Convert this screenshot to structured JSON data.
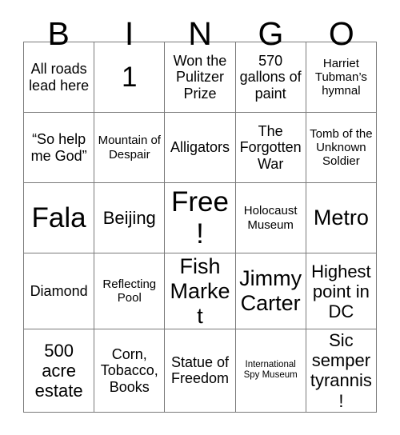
{
  "card": {
    "header_letters": [
      "B",
      "I",
      "N",
      "G",
      "O"
    ],
    "columns": 5,
    "rows": 5,
    "border_color": "#7a7a7a",
    "background_color": "#ffffff",
    "text_color": "#000000",
    "free_space": "Free!",
    "cells": [
      [
        {
          "text": "All roads lead here",
          "size": "sz-md"
        },
        {
          "text": "1",
          "size": "sz-xxl"
        },
        {
          "text": "Won the Pulitzer Prize",
          "size": "sz-md"
        },
        {
          "text": "570 gallons of paint",
          "size": "sz-md"
        },
        {
          "text": "Harriet Tubman’s hymnal",
          "size": "sz-sm"
        }
      ],
      [
        {
          "text": "“So help me God”",
          "size": "sz-md"
        },
        {
          "text": "Mountain of Despair",
          "size": "sz-sm"
        },
        {
          "text": "Alligators",
          "size": "sz-md"
        },
        {
          "text": "The Forgotten War",
          "size": "sz-md"
        },
        {
          "text": "Tomb of the Unknown Soldier",
          "size": "sz-sm"
        }
      ],
      [
        {
          "text": "Fala",
          "size": "sz-xxl"
        },
        {
          "text": "Beijing",
          "size": "sz-lg"
        },
        {
          "text": "Free!",
          "size": "sz-xxl"
        },
        {
          "text": "Holocaust Museum",
          "size": "sz-sm"
        },
        {
          "text": "Metro",
          "size": "sz-xl"
        }
      ],
      [
        {
          "text": "Diamond",
          "size": "sz-md"
        },
        {
          "text": "Reflecting Pool",
          "size": "sz-sm"
        },
        {
          "text": "Fish Market",
          "size": "sz-xl"
        },
        {
          "text": "Jimmy Carter",
          "size": "sz-xl"
        },
        {
          "text": "Highest point in DC",
          "size": "sz-lg"
        }
      ],
      [
        {
          "text": "500 acre estate",
          "size": "sz-lg"
        },
        {
          "text": "Corn, Tobacco, Books",
          "size": "sz-md"
        },
        {
          "text": "Statue of Freedom",
          "size": "sz-md"
        },
        {
          "text": "International Spy Museum",
          "size": "sz-xs"
        },
        {
          "text": "Sic semper tyrannis!",
          "size": "sz-lg"
        }
      ]
    ]
  }
}
